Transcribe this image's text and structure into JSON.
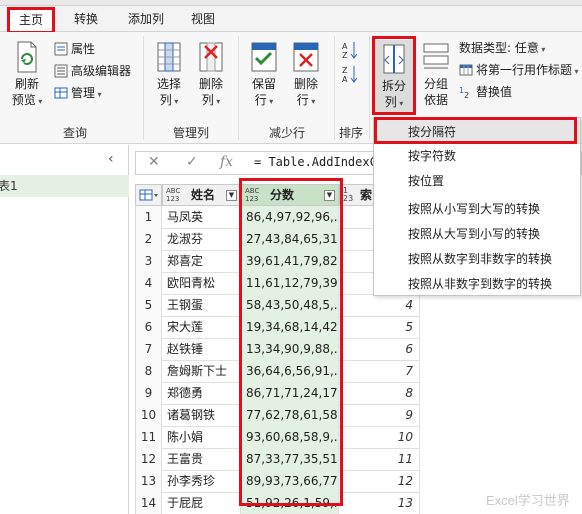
{
  "tabs": [
    "主页",
    "转换",
    "添加列",
    "视图"
  ],
  "ribbon": {
    "refresh": [
      "刷新",
      "预览"
    ],
    "properties": "属性",
    "advanced_editor": "高级编辑器",
    "manage": "管理",
    "group_query": "查询",
    "choose_columns": [
      "选择",
      "列"
    ],
    "remove_columns": [
      "删除",
      "列"
    ],
    "group_manage_columns": "管理列",
    "keep_rows": [
      "保留",
      "行"
    ],
    "remove_rows": [
      "删除",
      "行"
    ],
    "group_reduce_rows": "减少行",
    "group_sort": "排序",
    "split_column": [
      "拆分",
      "列"
    ],
    "group_by": [
      "分组",
      "依据"
    ],
    "data_type": "数据类型: 任意",
    "use_first_row": "将第一行用作标题",
    "replace_values": "替换值"
  },
  "left_pane": {
    "query_name": "表1"
  },
  "formula_bar": {
    "text": "= Table.AddIndexCo"
  },
  "table": {
    "columns": [
      {
        "type": "ABC\n123",
        "name": "姓名"
      },
      {
        "type": "ABC\n123",
        "name": "分数"
      },
      {
        "type": "1\n23",
        "name": "索"
      }
    ],
    "rows": [
      {
        "idx": "1",
        "name": "马凤英",
        "score": "86,4,97,92,96,...",
        "index": ""
      },
      {
        "idx": "2",
        "name": "龙淑芬",
        "score": "27,43,84,65,31...",
        "index": ""
      },
      {
        "idx": "3",
        "name": "郑喜定",
        "score": "39,61,41,79,82...",
        "index": ""
      },
      {
        "idx": "4",
        "name": "欧阳青松",
        "score": "11,61,12,79,39...",
        "index": ""
      },
      {
        "idx": "5",
        "name": "王钢蛋",
        "score": "58,43,50,48,5,...",
        "index": "4"
      },
      {
        "idx": "6",
        "name": "宋大莲",
        "score": "19,34,68,14,42...",
        "index": "5"
      },
      {
        "idx": "7",
        "name": "赵铁锤",
        "score": "13,34,90,9,88,...",
        "index": "6"
      },
      {
        "idx": "8",
        "name": "詹姆斯下士",
        "score": "36,64,6,56,91,...",
        "index": "7"
      },
      {
        "idx": "9",
        "name": "郑德勇",
        "score": "86,71,71,24,17...",
        "index": "8"
      },
      {
        "idx": "10",
        "name": "诸葛钢铁",
        "score": "77,62,78,61,58...",
        "index": "9"
      },
      {
        "idx": "11",
        "name": "陈小娟",
        "score": "93,60,68,58,9,...",
        "index": "10"
      },
      {
        "idx": "12",
        "name": "王富贵",
        "score": "87,33,77,35,51...",
        "index": "11"
      },
      {
        "idx": "13",
        "name": "孙李秀珍",
        "score": "89,93,73,66,77...",
        "index": "12"
      },
      {
        "idx": "14",
        "name": "于屁屁",
        "score": "51,92,26,1,59,...",
        "index": "13"
      }
    ]
  },
  "split_menu": [
    "按分隔符",
    "按字符数",
    "按位置",
    "按照从小写到大写的转换",
    "按照从大写到小写的转换",
    "按照从数字到非数字的转换",
    "按照从非数字到数字的转换"
  ],
  "watermark": "Excel学习世界",
  "colors": {
    "highlight_red": "#e0101a",
    "selected_column": "#e3f1e3",
    "query_selected": "#e5f1e5"
  }
}
